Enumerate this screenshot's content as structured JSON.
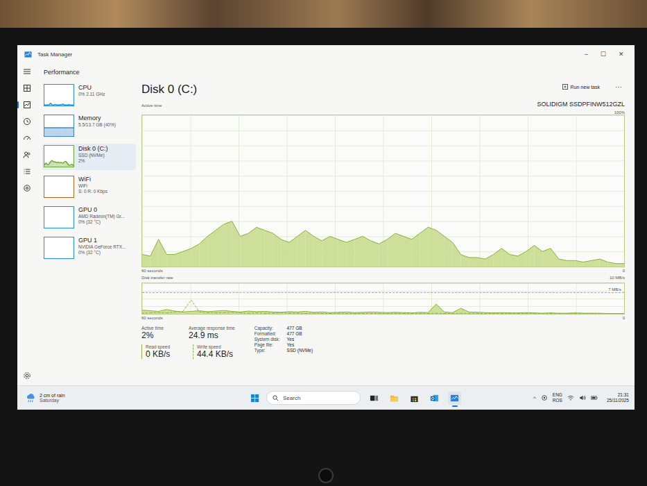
{
  "window": {
    "title": "Task Manager",
    "controls": [
      "–",
      "☐",
      "✕"
    ]
  },
  "header": {
    "title": "Performance"
  },
  "nav": [
    {
      "kind": "processes",
      "selected": false
    },
    {
      "kind": "performance",
      "selected": true
    },
    {
      "kind": "history",
      "selected": false
    },
    {
      "kind": "startup",
      "selected": false
    },
    {
      "kind": "users",
      "selected": false
    },
    {
      "kind": "details",
      "selected": false
    },
    {
      "kind": "services",
      "selected": false
    }
  ],
  "sidebar": [
    {
      "name": "CPU",
      "lines": [
        "0% 2.11 GHz"
      ],
      "selected": false,
      "color": "#1f8fe0",
      "spark": [
        3,
        2,
        4,
        2,
        12,
        3,
        2,
        6,
        3,
        2,
        4,
        3,
        8,
        2,
        3,
        2,
        5,
        2,
        3,
        2
      ]
    },
    {
      "name": "Memory",
      "lines": [
        "5.5/13.7 GB (40%)"
      ],
      "selected": false,
      "color": "#3a84c4",
      "spark": [
        40,
        40,
        40,
        40,
        40,
        40,
        40,
        40,
        40,
        40,
        40,
        40,
        40,
        40,
        40,
        40,
        40,
        40,
        40,
        40
      ]
    },
    {
      "name": "Disk 0 (C:)",
      "lines": [
        "SSD (NVMe)",
        "2%"
      ],
      "selected": true,
      "color": "#6aa82a",
      "spark": [
        8,
        18,
        8,
        12,
        24,
        30,
        22,
        24,
        18,
        22,
        18,
        20,
        16,
        22,
        26,
        16,
        6,
        8,
        12,
        4
      ]
    },
    {
      "name": "WiFi",
      "lines": [
        "WiFi",
        "S: 0 R: 0 Kbps"
      ],
      "selected": false,
      "color": "#b5651d",
      "spark": []
    },
    {
      "name": "GPU 0",
      "lines": [
        "AMD Radeon(TM) Gr...",
        "0% (32 °C)"
      ],
      "selected": false,
      "color": "#1f8fe0",
      "spark": []
    },
    {
      "name": "GPU 1",
      "lines": [
        "NVIDIA GeForce RTX...",
        "0% (32 °C)"
      ],
      "selected": false,
      "color": "#1f8fe0",
      "spark": []
    }
  ],
  "main": {
    "title": "Disk 0 (C:)",
    "model": "SOLIDIGM SSDPFINW512GZL",
    "run_task": "Run new task",
    "more": "⋯",
    "active_chart": {
      "label": "Active time",
      "max_label": "100%",
      "span": "60 seconds",
      "min_label": "0",
      "values": [
        8,
        7,
        18,
        8,
        8,
        10,
        12,
        15,
        20,
        24,
        28,
        30,
        20,
        22,
        26,
        24,
        22,
        18,
        16,
        20,
        24,
        20,
        17,
        20,
        18,
        16,
        18,
        20,
        17,
        15,
        18,
        22,
        20,
        18,
        22,
        26,
        24,
        20,
        16,
        8,
        6,
        6,
        5,
        8,
        12,
        8,
        7,
        10,
        14,
        10,
        12,
        5,
        4,
        4,
        3,
        4,
        5,
        3,
        2,
        2
      ]
    },
    "transfer_chart": {
      "label": "Disk transfer rate",
      "max_label": "10 MB/s",
      "mid_label": "7 MB/s",
      "span": "60 seconds",
      "min_label": "0",
      "write": [
        1.2,
        1.0,
        0.8,
        1.4,
        0.9,
        0.6,
        0.8,
        1.0,
        0.7,
        0.9,
        1.1,
        0.8,
        0.6,
        0.9,
        0.7,
        0.8,
        0.6,
        0.5,
        0.7,
        0.6,
        0.8,
        0.5,
        0.6,
        0.4,
        0.5,
        0.6,
        0.4,
        0.5,
        0.6,
        0.5,
        0.4,
        0.5,
        0.4,
        0.3,
        0.5,
        0.4,
        3.2,
        0.6,
        0.4,
        1.8,
        0.6,
        0.5,
        0.4,
        0.3,
        0.4,
        0.3,
        0.3,
        0.4,
        0.3,
        0.2,
        0.3,
        0.2,
        0.2,
        0.3,
        0.2,
        0.2,
        0.2,
        0.1,
        0.1,
        0.1
      ],
      "read": [
        0.2,
        0.3,
        0.4,
        0.3,
        0.6,
        0.8,
        4.5,
        0.6,
        0.4,
        0.3,
        0.4,
        0.5,
        0.3,
        0.2,
        0.3,
        0.2,
        0.2,
        0.3,
        0.2,
        0.2,
        0.1,
        0.2,
        0.1,
        0.1,
        0.2,
        0.1,
        0.1,
        0.1,
        0.1,
        0.1,
        0.1,
        0.1,
        0.1,
        0.1,
        0.1,
        0.1,
        0.2,
        0.1,
        0.1,
        0.2,
        0.1,
        0.1,
        0.1,
        0.1,
        0.1,
        0.1,
        0.1,
        0.1,
        0.1,
        0.1,
        0.1,
        0.1,
        0.1,
        0.1,
        0.1,
        0.1,
        0.1,
        0.1,
        0.1,
        0.1
      ]
    },
    "stats": [
      {
        "label": "Active time",
        "value": "2%"
      },
      {
        "label": "Average response time",
        "value": "24.9 ms"
      }
    ],
    "speeds": [
      {
        "label": "Read speed",
        "value": "0 KB/s"
      },
      {
        "label": "Write speed",
        "value": "44.4 KB/s"
      }
    ],
    "props": [
      {
        "key": "Capacity:",
        "value": "477 GB"
      },
      {
        "key": "Formatted:",
        "value": "477 GB"
      },
      {
        "key": "System disk:",
        "value": "Yes"
      },
      {
        "key": "Page file:",
        "value": "Yes"
      },
      {
        "key": "Type:",
        "value": "SSD (NVMe)"
      }
    ]
  },
  "taskbar": {
    "weather": {
      "line1": "2 cm of rain",
      "line2": "Saturday"
    },
    "search": {
      "placeholder": "Search"
    },
    "apps": [
      {
        "kind": "taskview",
        "selected": false
      },
      {
        "kind": "explorer",
        "selected": false
      },
      {
        "kind": "store",
        "selected": false
      },
      {
        "kind": "outlook",
        "selected": false
      },
      {
        "kind": "taskmanager",
        "selected": true
      }
    ],
    "tray": {
      "chevron": "^",
      "lang": "ENG",
      "layout": "ROS",
      "time": "21:31",
      "date": "25/11/2025"
    }
  }
}
